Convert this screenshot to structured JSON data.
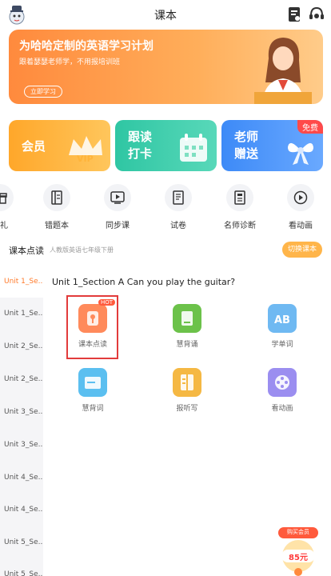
{
  "header": {
    "title": "课本"
  },
  "banner": {
    "title": "为哈哈定制的英语学习计划",
    "subtitle": "跟着瑟瑟老师学，不用报培训班",
    "button": "立即学习"
  },
  "tiles": [
    {
      "label_line1": "会员",
      "label_line2": "",
      "deco": "VIP"
    },
    {
      "label_line1": "跟读",
      "label_line2": "打卡",
      "deco": ""
    },
    {
      "label_line1": "老师",
      "label_line2": "赠送",
      "badge": "免费"
    }
  ],
  "icon_row": [
    {
      "label": "有礼",
      "icon": "gift-icon"
    },
    {
      "label": "错题本",
      "icon": "notebook-icon"
    },
    {
      "label": "同步课",
      "icon": "video-icon"
    },
    {
      "label": "试卷",
      "icon": "exam-icon"
    },
    {
      "label": "名师诊断",
      "icon": "diagnosis-icon"
    },
    {
      "label": "看动画",
      "icon": "play-icon"
    }
  ],
  "section": {
    "title": "课本点读",
    "subtitle": "人教版英语七年级下册",
    "switch_button": "切换课本"
  },
  "sidebar": {
    "items": [
      "Unit 1_Se...",
      "Unit 1_Se...",
      "Unit 2_Se...",
      "Unit 2_Se...",
      "Unit 3_Se...",
      "Unit 3_Se...",
      "Unit 4_Se...",
      "Unit 4_Se...",
      "Unit 5_Se...",
      "Unit 5_Se..."
    ]
  },
  "content": {
    "unit_title": "Unit 1_Section A Can you play the guitar?",
    "features": [
      {
        "label": "课本点读",
        "icon": "book-reading-icon",
        "hot": "HOT",
        "color": "#ff8a5b"
      },
      {
        "label": "慧背诵",
        "icon": "recite-icon",
        "color": "#6cc24a"
      },
      {
        "label": "学单词",
        "icon": "ab-words-icon",
        "color": "#6fb9f2"
      },
      {
        "label": "慧背词",
        "icon": "card-icon",
        "color": "#5bbff0"
      },
      {
        "label": "报听写",
        "icon": "dictation-icon",
        "color": "#f5b843"
      },
      {
        "label": "看动画",
        "icon": "film-icon",
        "color": "#9b8ef0"
      }
    ]
  },
  "promo": {
    "label": "购买会员",
    "price": "85元"
  },
  "colors": {
    "accent": "#ff7a2a",
    "switch_btn": "#ffb54a"
  }
}
